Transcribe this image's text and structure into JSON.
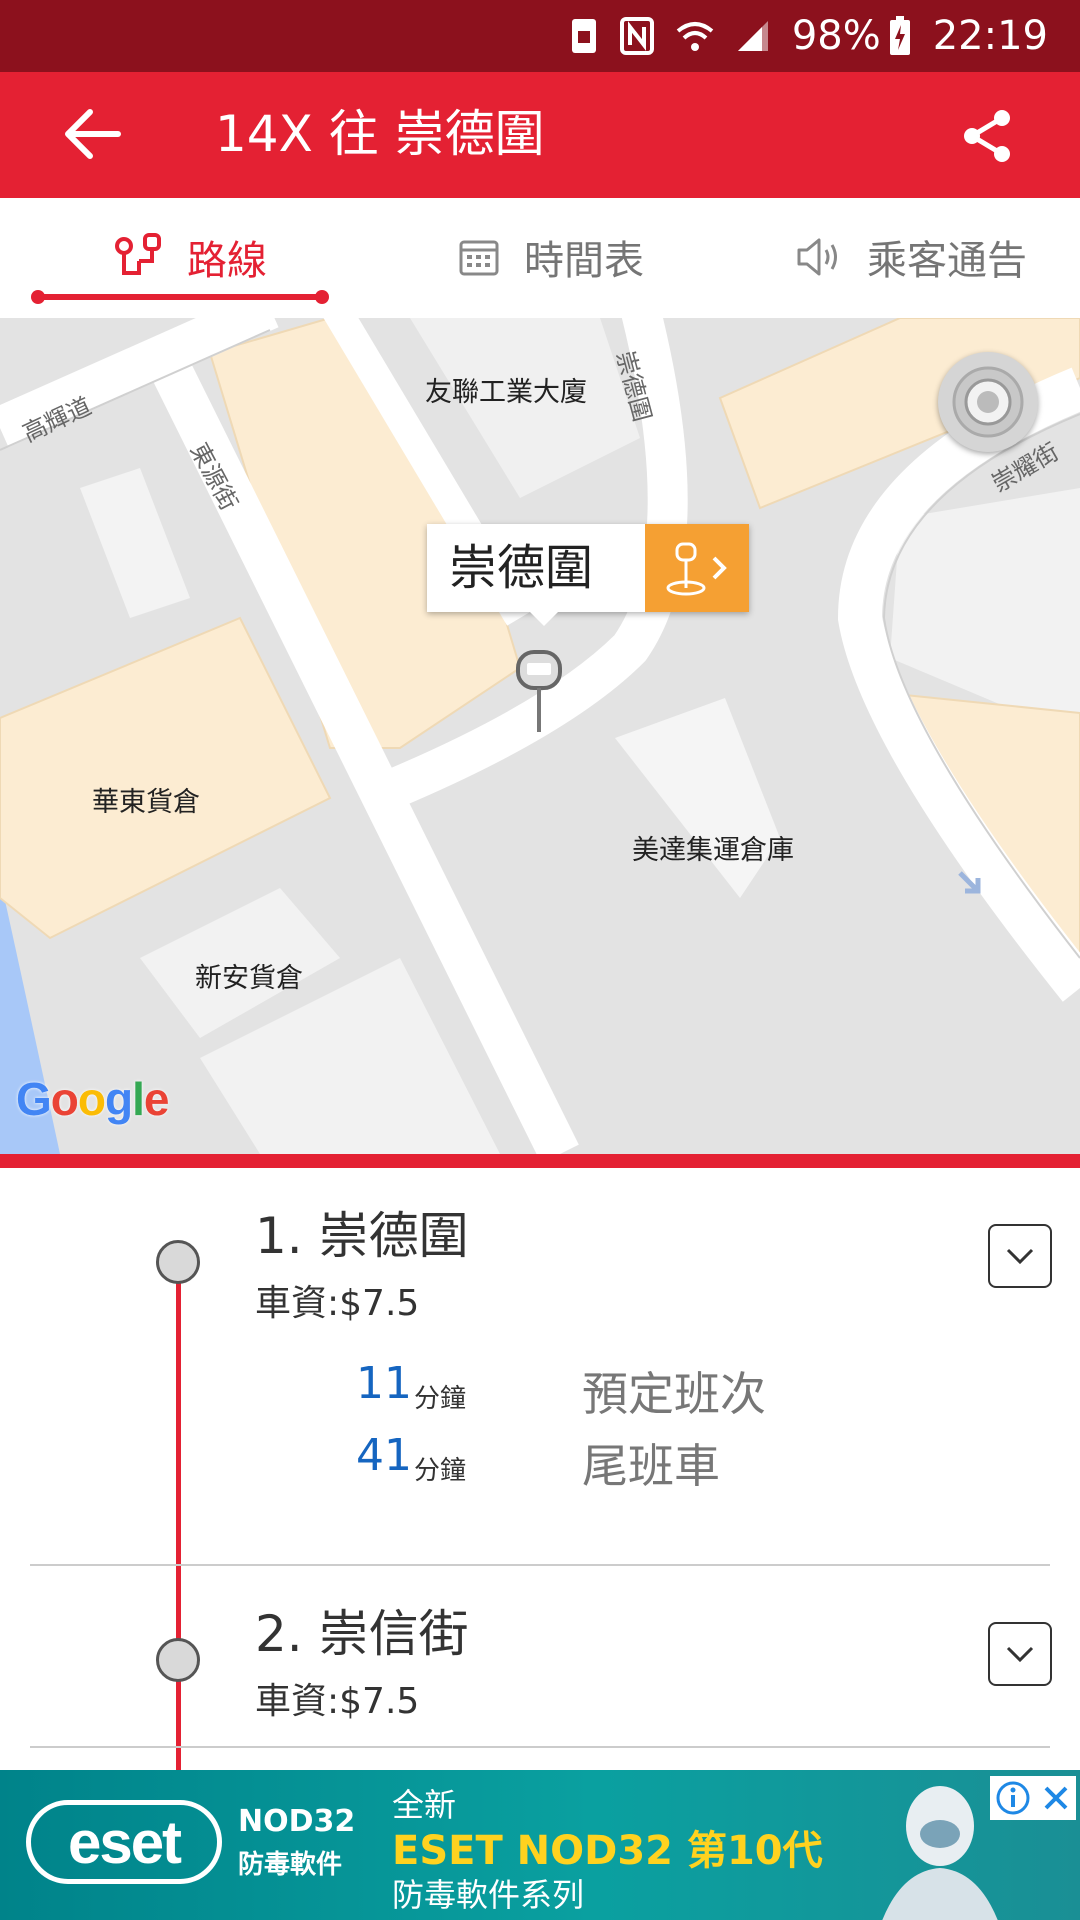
{
  "status_bar": {
    "battery": "98%",
    "time": "22:19"
  },
  "header": {
    "title": "14X 往 崇德圍"
  },
  "tabs": [
    {
      "label": "路線",
      "active": true
    },
    {
      "label": "時間表",
      "active": false
    },
    {
      "label": "乘客通告",
      "active": false
    }
  ],
  "map": {
    "labels": {
      "building1": "友聯工業大廈",
      "building2": "華東貨倉",
      "building3": "美達集運倉庫",
      "building4": "新安貨倉",
      "street1": "高輝道",
      "street2": "東源街",
      "street3": "崇德圍",
      "street4": "崇耀街"
    },
    "popup": {
      "name": "崇德圍"
    },
    "brand": "Google"
  },
  "stops": [
    {
      "name": "1. 崇德圍",
      "fare": "車資:$7.5",
      "etas": [
        {
          "minutes": "11",
          "unit": "分鐘",
          "note": "預定班次"
        },
        {
          "minutes": "41",
          "unit": "分鐘",
          "note": "尾班車"
        }
      ]
    },
    {
      "name": "2. 崇信街",
      "fare": "車資:$7.5"
    }
  ],
  "ad": {
    "brand": "eset",
    "product": "NOD32",
    "product_sub": "防毒軟件",
    "line1": "全新",
    "line2": "ESET NOD32 第10代",
    "line3": "防毒軟件系列"
  },
  "colors": {
    "primary": "#e42133",
    "status_bar": "#8c111d",
    "accent": "#f5a033",
    "eta": "#1565c0"
  }
}
